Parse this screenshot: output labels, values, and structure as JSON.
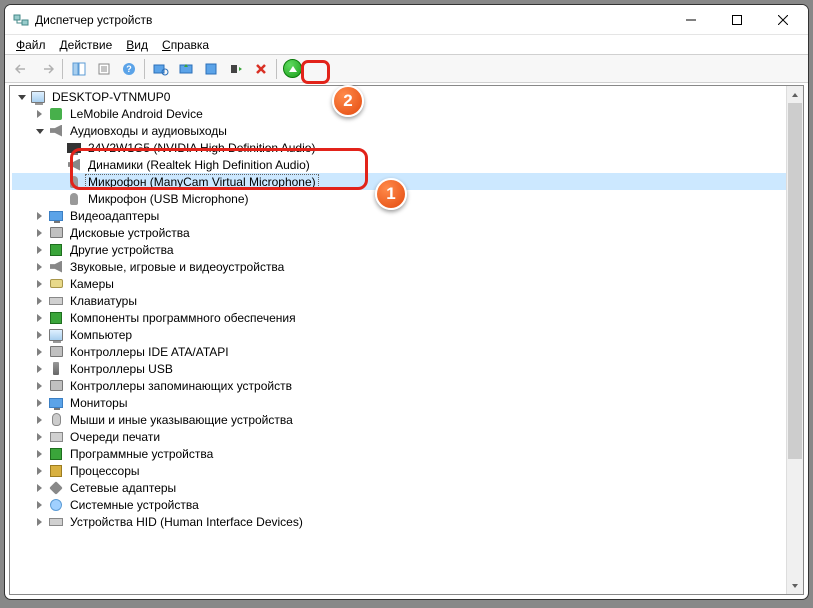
{
  "window": {
    "title": "Диспетчер устройств"
  },
  "menu": {
    "file": "Файл",
    "action": "Действие",
    "view": "Вид",
    "help": "Справка"
  },
  "tree": {
    "root": "DESKTOP-VTNMUP0",
    "android": "LeMobile Android Device",
    "audio_group": "Аудиовходы и аудиовыходы",
    "audio_items": [
      "24V2W1G5 (NVIDIA High Definition Audio)",
      "Динамики (Realtek High Definition Audio)",
      "Микрофон (ManyCam Virtual Microphone)",
      "Микрофон (USB Microphone)"
    ],
    "categories": [
      "Видеоадаптеры",
      "Дисковые устройства",
      "Другие устройства",
      "Звуковые, игровые и видеоустройства",
      "Камеры",
      "Клавиатуры",
      "Компоненты программного обеспечения",
      "Компьютер",
      "Контроллеры IDE ATA/ATAPI",
      "Контроллеры USB",
      "Контроллеры запоминающих устройств",
      "Мониторы",
      "Мыши и иные указывающие устройства",
      "Очереди печати",
      "Программные устройства",
      "Процессоры",
      "Сетевые адаптеры",
      "Системные устройства",
      "Устройства HID (Human Interface Devices)"
    ]
  },
  "annotations": {
    "badge1": "1",
    "badge2": "2"
  }
}
